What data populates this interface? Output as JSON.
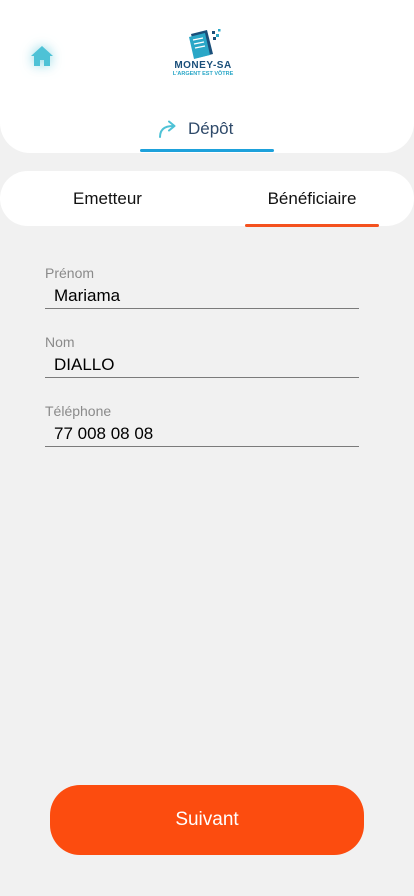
{
  "header": {
    "home_icon": "home-icon",
    "logo": {
      "name": "MONEY-SA",
      "tagline": "L'ARGENT EST VÔTRE"
    },
    "operation_tab": {
      "icon": "share-arrow-icon",
      "label": "Dépôt"
    }
  },
  "tabs": [
    {
      "label": "Emetteur",
      "active": false
    },
    {
      "label": "Bénéficiaire",
      "active": true
    }
  ],
  "form": {
    "prenom": {
      "label": "Prénom",
      "value": "Mariama"
    },
    "nom": {
      "label": "Nom",
      "value": "DIALLO"
    },
    "telephone": {
      "label": "Téléphone",
      "value": "77 008 08 08"
    }
  },
  "submit_label": "Suivant",
  "colors": {
    "accent_orange": "#fc4c0f",
    "accent_blue": "#1da1db",
    "teal": "#4ec2d6",
    "background": "#f1f1f1"
  }
}
